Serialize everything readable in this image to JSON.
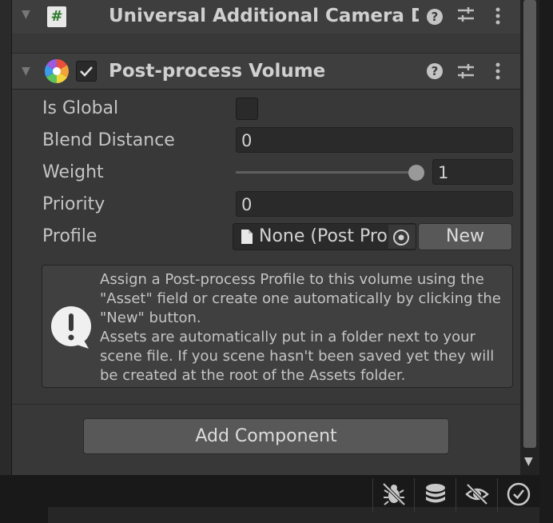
{
  "components": {
    "camera_data": {
      "title": "Universal Additional Camera Data"
    },
    "post_process": {
      "title": "Post-process Volume",
      "enabled": true
    }
  },
  "fields": {
    "is_global": {
      "label": "Is Global",
      "checked": false
    },
    "blend_distance": {
      "label": "Blend Distance",
      "value": "0"
    },
    "weight": {
      "label": "Weight",
      "value": "1",
      "slider_fraction": 1.0
    },
    "priority": {
      "label": "Priority",
      "value": "0"
    },
    "profile": {
      "label": "Profile",
      "value": "None (Post Process Profile)",
      "new_label": "New"
    }
  },
  "help": {
    "text": "Assign a Post-process Profile to this volume using the \"Asset\" field or create one automatically by clicking the \"New\" button.\nAssets are automatically put in a folder next to your scene file. If you scene hasn't been saved yet they will be created at the root of the Assets folder."
  },
  "add_component_label": "Add Component",
  "status_icons": [
    "bug-off-icon",
    "database-stack-icon",
    "eye-off-icon",
    "check-circle-icon"
  ]
}
